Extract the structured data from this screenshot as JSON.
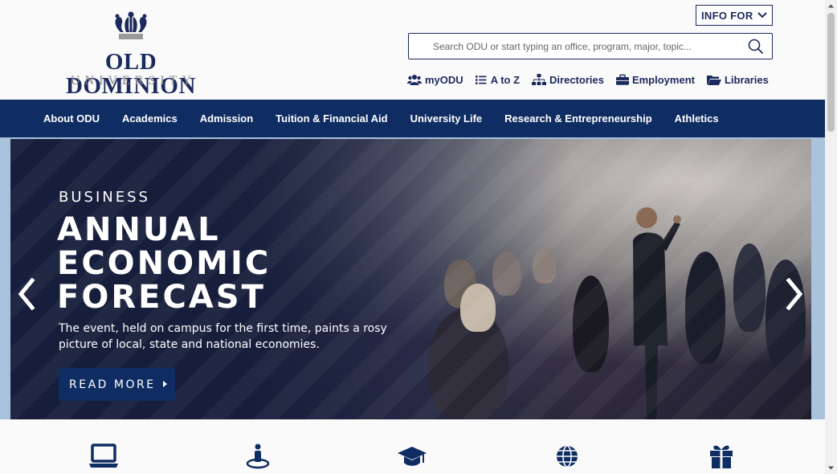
{
  "header": {
    "logo_title": "OLD DOMINION",
    "logo_subtitle": "UNIVERSITY",
    "info_for_label": "INFO FOR",
    "search_placeholder": "Search ODU or start typing an office, program, major, topic...",
    "quick_links": [
      {
        "label": "myODU",
        "icon": "users-icon"
      },
      {
        "label": "A to Z",
        "icon": "list-icon"
      },
      {
        "label": "Directories",
        "icon": "sitemap-icon"
      },
      {
        "label": "Employment",
        "icon": "briefcase-icon"
      },
      {
        "label": "Libraries",
        "icon": "folder-open-icon"
      }
    ]
  },
  "nav": {
    "items": [
      "About ODU",
      "Academics",
      "Admission",
      "Tuition & Financial Aid",
      "University Life",
      "Research & Entrepreneurship",
      "Athletics"
    ]
  },
  "hero": {
    "kicker": "BUSINESS",
    "title_lines": [
      "ANNUAL",
      "ECONOMIC",
      "FORECAST"
    ],
    "description": "The event, held on campus for the first time, paints a rosy picture of local, state and national economies.",
    "cta_label": "READ MORE"
  },
  "features": {
    "icons": [
      "laptop-icon",
      "person-location-icon",
      "graduation-cap-icon",
      "globe-icon",
      "gift-icon"
    ]
  },
  "colors": {
    "brand_navy": "#0f2d63",
    "logo_navy": "#1b2a5c",
    "hero_border": "#a9c2de"
  }
}
